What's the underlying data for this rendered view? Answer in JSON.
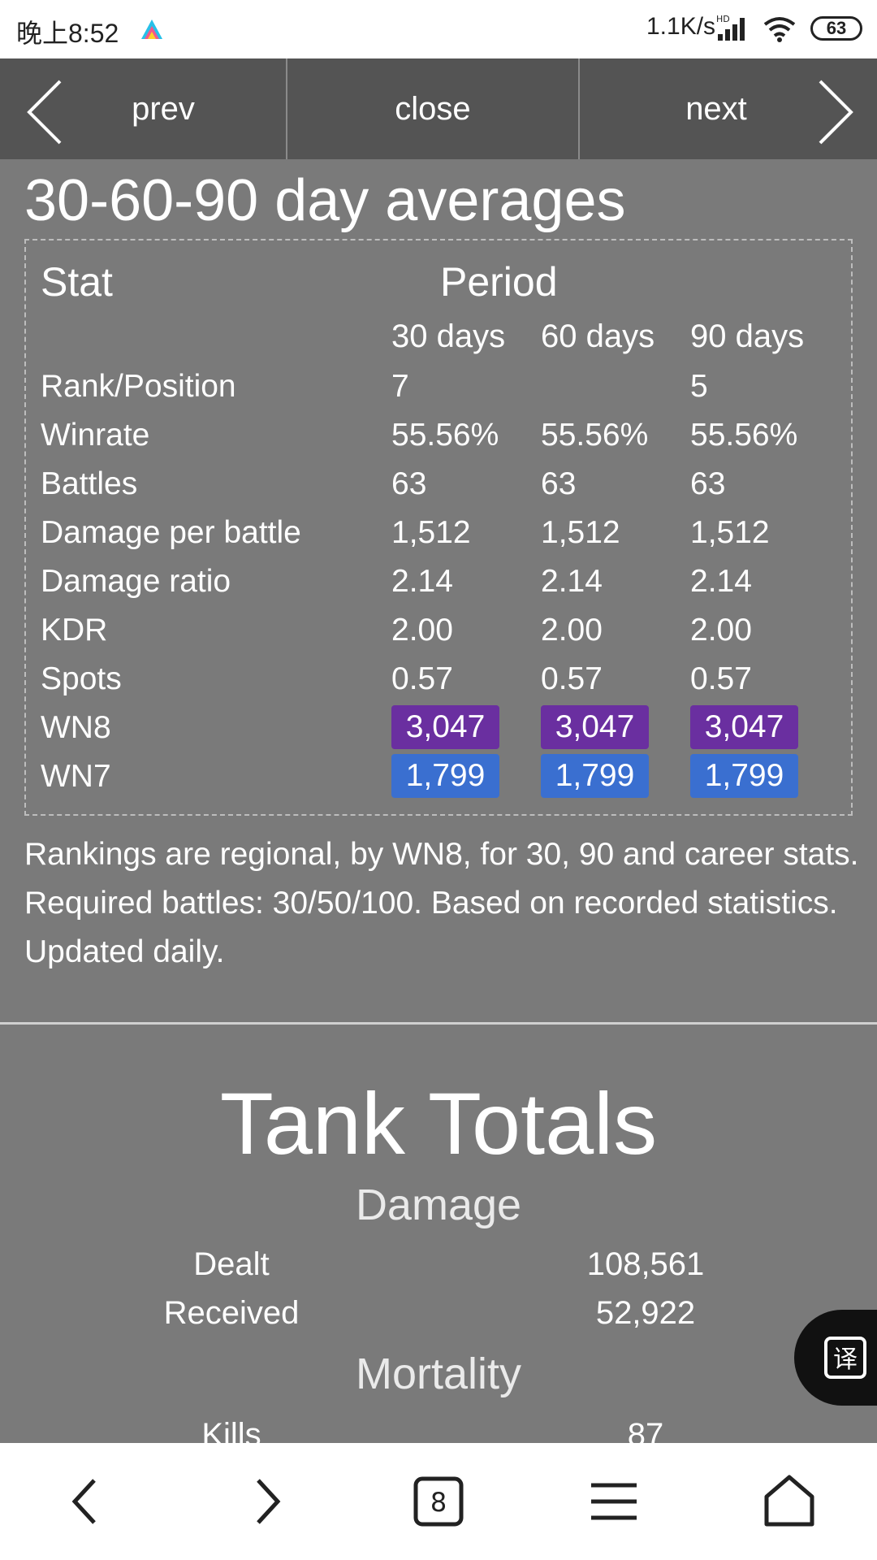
{
  "status_bar": {
    "time": "晚上8:52",
    "network_speed": "1.1K/s",
    "signal_label": "HD",
    "battery": "63"
  },
  "nav": {
    "prev_label": "prev",
    "close_label": "close",
    "next_label": "next"
  },
  "averages": {
    "title": "30-60-90 day averages",
    "header_stat": "Stat",
    "header_period": "Period",
    "columns": [
      "30 days",
      "60 days",
      "90 days"
    ],
    "rows": [
      {
        "label": "Rank/Position",
        "values": [
          "7",
          "",
          "5"
        ]
      },
      {
        "label": "Winrate",
        "values": [
          "55.56%",
          "55.56%",
          "55.56%"
        ]
      },
      {
        "label": "Battles",
        "values": [
          "63",
          "63",
          "63"
        ]
      },
      {
        "label": "Damage per battle",
        "values": [
          "1,512",
          "1,512",
          "1,512"
        ]
      },
      {
        "label": "Damage ratio",
        "values": [
          "2.14",
          "2.14",
          "2.14"
        ]
      },
      {
        "label": "KDR",
        "values": [
          "2.00",
          "2.00",
          "2.00"
        ]
      },
      {
        "label": "Spots",
        "values": [
          "0.57",
          "0.57",
          "0.57"
        ]
      },
      {
        "label": "WN8",
        "values": [
          "3,047",
          "3,047",
          "3,047"
        ]
      },
      {
        "label": "WN7",
        "values": [
          "1,799",
          "1,799",
          "1,799"
        ]
      }
    ],
    "wn8_color": "#6a2fa0",
    "wn7_color": "#3a6fd0",
    "note": "Rankings are regional, by WN8, for 30, 90 and career stats. Required battles: 30/50/100. Based on recorded statistics. Updated daily."
  },
  "totals": {
    "title": "Tank Totals",
    "damage_heading": "Damage",
    "damage": [
      {
        "label": "Dealt",
        "value": "108,561"
      },
      {
        "label": "Received",
        "value": "52,922"
      }
    ],
    "mortality_heading": "Mortality",
    "mortality": [
      {
        "label": "Kills",
        "value": "87"
      }
    ]
  },
  "translate_button": {
    "icon": "translate-icon",
    "glyph": "译"
  },
  "browser_bar": {
    "tab_count": "8"
  }
}
